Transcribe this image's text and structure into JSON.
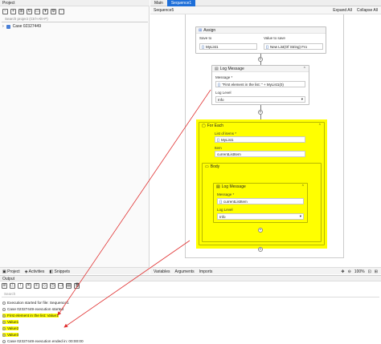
{
  "project_panel": {
    "title": "Project",
    "search_placeholder": "Search project (Ctrl+Alt+P)",
    "tree_item": "Case 02327449",
    "tabs": [
      "Project",
      "Activities",
      "Snippets"
    ]
  },
  "editor": {
    "tabs": [
      "Main",
      "Sequence1"
    ],
    "breadcrumb": "Sequence5",
    "expand_all": "Expand All",
    "collapse_all": "Collapse All",
    "bottom_tabs": [
      "Variables",
      "Arguments",
      "Imports"
    ],
    "zoom": "100%"
  },
  "assign": {
    "title": "Assign",
    "save_to_label": "Save to",
    "save_to_value": "MyList1",
    "value_label": "Value to save",
    "value_value": "New List(Of String) Fro"
  },
  "log1": {
    "title": "Log Message",
    "message_label": "Message *",
    "message_value": "\"First element in the list: \" + MyList1(0)",
    "level_label": "Log Level",
    "level_value": "Info"
  },
  "foreach": {
    "title": "For Each",
    "list_label": "List of items *",
    "list_value": "MyList1",
    "item_label": "Item",
    "item_value": "currentListItem",
    "body_title": "Body"
  },
  "log2": {
    "title": "Log Message",
    "message_label": "Message *",
    "message_value": "currentListItem",
    "level_label": "Log Level",
    "level_value": "Info"
  },
  "output": {
    "title": "Output",
    "search_placeholder": "Search",
    "lines": [
      "Execution started for file: Sequence1",
      "Case 02327449 execution started",
      "First element in the list: Value1",
      "Value1",
      "Value2",
      "Value3",
      "Case 02327449 execution ended in: 00:00:00"
    ]
  },
  "colors": {
    "highlight": "#ffff00",
    "accent": "#1e6fd9",
    "arrow": "#e03030"
  }
}
